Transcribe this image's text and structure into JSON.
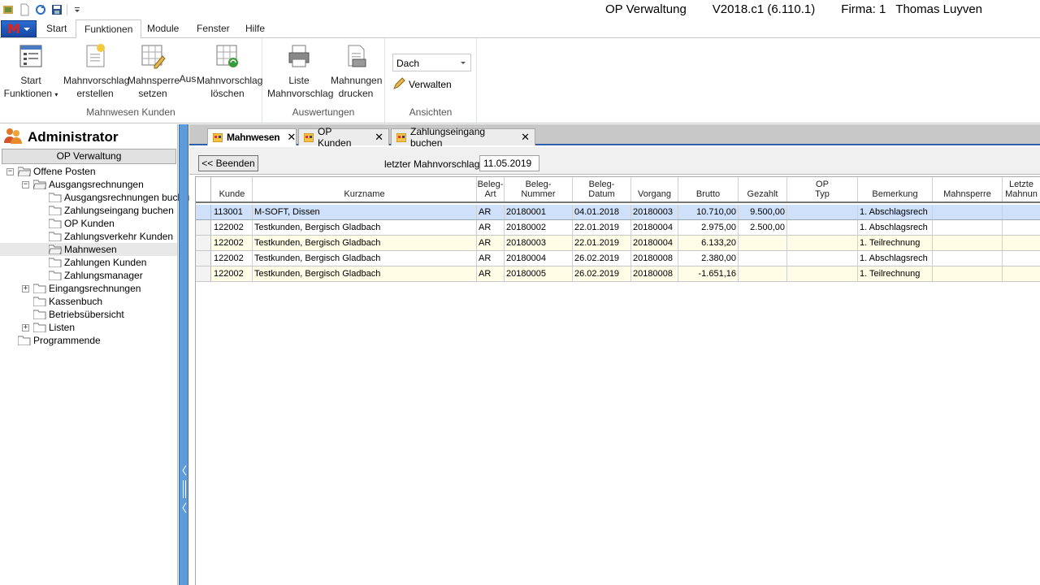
{
  "title": {
    "app": "OP Verwaltung",
    "version": "V2018.c1 (6.110.1)",
    "firma": "Firma: 1",
    "user": "Thomas Luyven"
  },
  "ribbon_tabs": [
    "Start",
    "Funktionen",
    "Module",
    "Fenster",
    "Hilfe"
  ],
  "ribbon": {
    "groups": {
      "mahnwesen": "Mahnwesen Kunden",
      "auswertungen": "Auswertungen",
      "ansichten": "Ansichten"
    },
    "start_funktionen": [
      "Start",
      "Funktionen"
    ],
    "mahnvorschlag_erstellen": [
      "Mahnvorschlag",
      "erstellen"
    ],
    "mahnsperre_setzen": [
      "Mahnsperre",
      "setzen"
    ],
    "aus": "Aus",
    "mahnvorschlag_loeschen": [
      "Mahnvorschlag",
      "löschen"
    ],
    "liste_mahnvorschlag": [
      "Liste",
      "Mahnvorschlag"
    ],
    "mahnungen_drucken": [
      "Mahnungen",
      "drucken"
    ],
    "ansicht_value": "Dach",
    "verwalten": "Verwalten"
  },
  "left": {
    "admin": "Administrator",
    "op_bar": "OP Verwaltung",
    "tree": {
      "offene_posten": "Offene Posten",
      "ausgangsrechnungen": "Ausgangsrechnungen",
      "ausgangsrechnungen_buchen": "Ausgangsrechnungen buchen",
      "zahlungseingang_buchen": "Zahlungseingang buchen",
      "op_kunden": "OP Kunden",
      "zahlungsverkehr_kunden": "Zahlungsverkehr Kunden",
      "mahnwesen": "Mahnwesen",
      "zahlungen_kunden": "Zahlungen Kunden",
      "zahlungsmanager": "Zahlungsmanager",
      "eingangsrechnungen": "Eingangsrechnungen",
      "kassenbuch": "Kassenbuch",
      "betriebsuebersicht": "Betriebsübersicht",
      "listen": "Listen",
      "programmende": "Programmende"
    }
  },
  "doc_tabs": [
    "Mahnwesen",
    "OP Kunden",
    "Zahlungseingang buchen"
  ],
  "toolbar": {
    "beenden": "<< Beenden",
    "letzter_label": "letzter Mahnvorschlag",
    "letzter_value": "11.05.2019"
  },
  "grid": {
    "headers": [
      "Kunde",
      "Kurzname",
      "Beleg-\nArt",
      "Beleg-\nNummer",
      "Beleg-\nDatum",
      "Vorgang",
      "Brutto",
      "Gezahlt",
      "OP\nTyp",
      "Bemerkung",
      "Mahnsperre",
      "Letzte\nMahnun"
    ],
    "rows": [
      [
        "113001",
        "M-SOFT, Dissen",
        "AR",
        "20180001",
        "04.01.2018",
        "20180003",
        "10.710,00",
        "9.500,00",
        "",
        "1. Abschlagsrech",
        "",
        ""
      ],
      [
        "122002",
        "Testkunden, Bergisch Gladbach",
        "AR",
        "20180002",
        "22.01.2019",
        "20180004",
        "2.975,00",
        "2.500,00",
        "",
        "1. Abschlagsrech",
        "",
        ""
      ],
      [
        "122002",
        "Testkunden, Bergisch Gladbach",
        "AR",
        "20180003",
        "22.01.2019",
        "20180004",
        "6.133,20",
        "",
        "",
        "1. Teilrechnung",
        "",
        ""
      ],
      [
        "122002",
        "Testkunden, Bergisch Gladbach",
        "AR",
        "20180004",
        "26.02.2019",
        "20180008",
        "2.380,00",
        "",
        "",
        "1. Abschlagsrech",
        "",
        ""
      ],
      [
        "122002",
        "Testkunden, Bergisch Gladbach",
        "AR",
        "20180005",
        "26.02.2019",
        "20180008",
        "-1.651,16",
        "",
        "",
        "1. Teilrechnung",
        "",
        ""
      ]
    ]
  }
}
